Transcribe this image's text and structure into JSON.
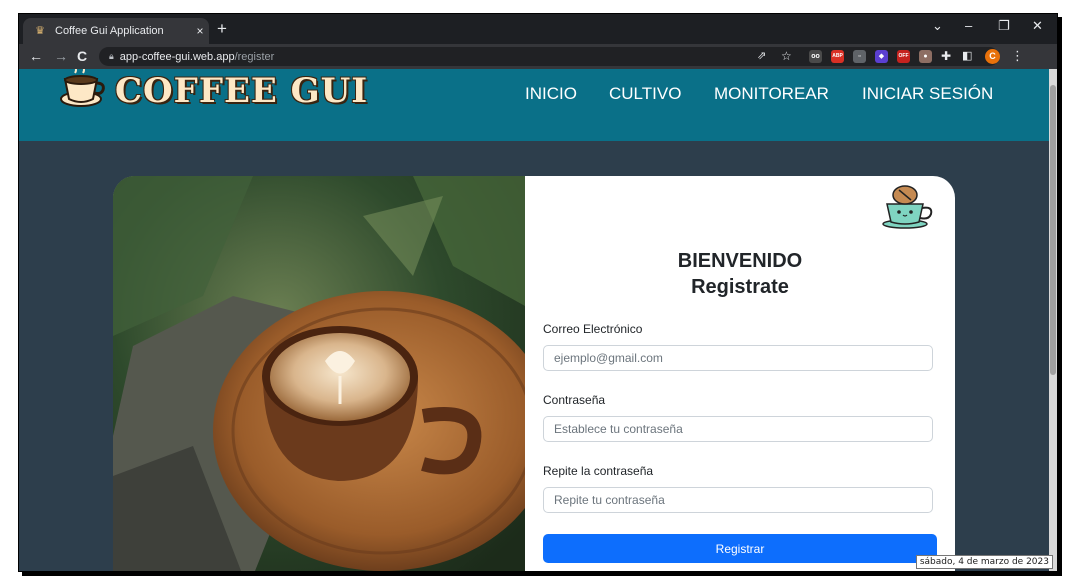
{
  "browser": {
    "tab_title": "Coffee Gui Application",
    "tab_close": "×",
    "new_tab": "+",
    "url_host": "app-coffee-gui.web.app",
    "url_path": "/register",
    "win_min": "–",
    "win_restore": "❐",
    "win_close": "✕",
    "win_menu": "⌄",
    "back": "←",
    "forward": "→",
    "reload": "C",
    "profile_initial": "C",
    "ext_abp": "ABP",
    "ext_off": "OFF"
  },
  "nav": {
    "brand": "COFFEE GUI",
    "items": [
      "INICIO",
      "CULTIVO",
      "MONITOREAR",
      "INICIAR SESIÓN"
    ]
  },
  "form": {
    "title_line1": "BIENVENIDO",
    "title_line2": "Registrate",
    "email_label": "Correo Electrónico",
    "email_placeholder": "ejemplo@gmail.com",
    "password_label": "Contraseña",
    "password_placeholder": "Establece tu contraseña",
    "repeat_label": "Repite la contraseña",
    "repeat_placeholder": "Repite tu contraseña",
    "submit_label": "Registrar"
  },
  "tooltip": "sábado, 4 de marzo de 2023",
  "colors": {
    "nav_bg": "#0a7088",
    "page_bg": "#2d3e4c",
    "button": "#0d6efd",
    "brand_text": "#fde8c6"
  },
  "icons": [
    "coffee-cup-icon",
    "coffee-mascot-icon",
    "lock-icon",
    "star-icon",
    "share-icon",
    "puzzle-icon"
  ]
}
